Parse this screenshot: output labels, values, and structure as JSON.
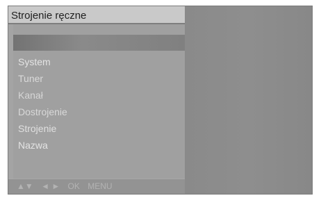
{
  "menu": {
    "title": "Strojenie ręczne",
    "items": [
      {
        "label": "System"
      },
      {
        "label": "Tuner"
      },
      {
        "label": "Kanał"
      },
      {
        "label": "Dostrojenie"
      },
      {
        "label": "Strojenie"
      },
      {
        "label": "Nazwa"
      }
    ]
  },
  "footer": {
    "updown_icon": "▲▼",
    "leftright_icon": "◄ ►",
    "ok_label": "OK",
    "menu_label": "MENU"
  }
}
